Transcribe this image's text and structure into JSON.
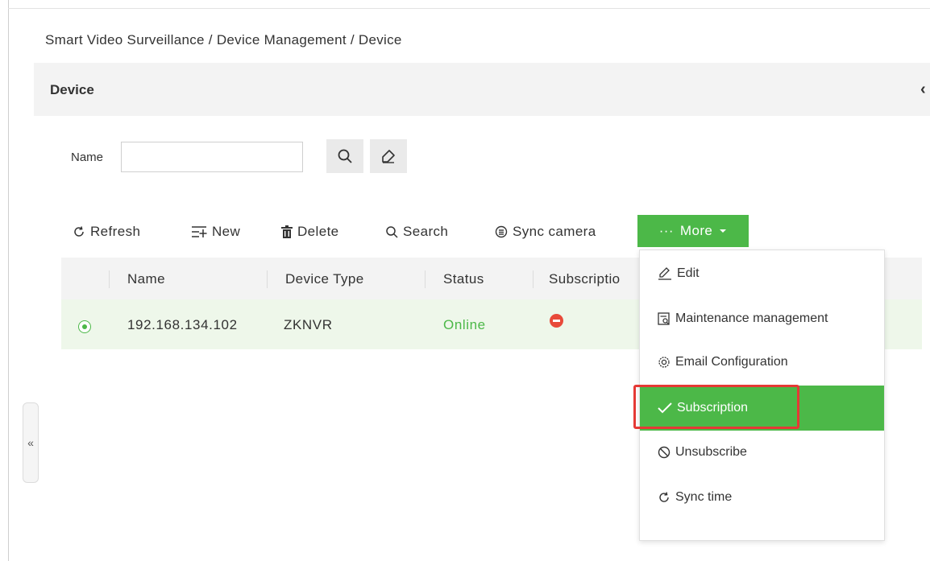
{
  "breadcrumb": "Smart Video Surveillance / Device Management / Device",
  "page_title": "Device",
  "filter": {
    "name_label": "Name",
    "name_value": "",
    "name_placeholder": ""
  },
  "toolbar": {
    "refresh": "Refresh",
    "new": "New",
    "delete": "Delete",
    "search": "Search",
    "sync_camera": "Sync camera",
    "more": "More"
  },
  "table": {
    "columns": [
      "Name",
      "Device Type",
      "Status",
      "Subscriptio"
    ],
    "rows": [
      {
        "name": "192.168.134.102",
        "device_type": "ZKNVR",
        "status": "Online",
        "subscription": "not-subscribed-icon"
      }
    ]
  },
  "more_menu": {
    "items": [
      {
        "label": "Edit",
        "icon": "edit-icon"
      },
      {
        "label": "Maintenance management",
        "icon": "maintenance-icon"
      },
      {
        "label": "Email Configuration",
        "icon": "email-config-icon"
      },
      {
        "label": "Subscription",
        "icon": "check-icon",
        "active": true
      },
      {
        "label": "Unsubscribe",
        "icon": "ban-icon"
      },
      {
        "label": "Sync time",
        "icon": "sync-icon"
      }
    ]
  },
  "colors": {
    "accent": "#4cb848",
    "status_online": "#4cb848",
    "highlight_border": "#e53935",
    "error_icon": "#e84a3a"
  }
}
